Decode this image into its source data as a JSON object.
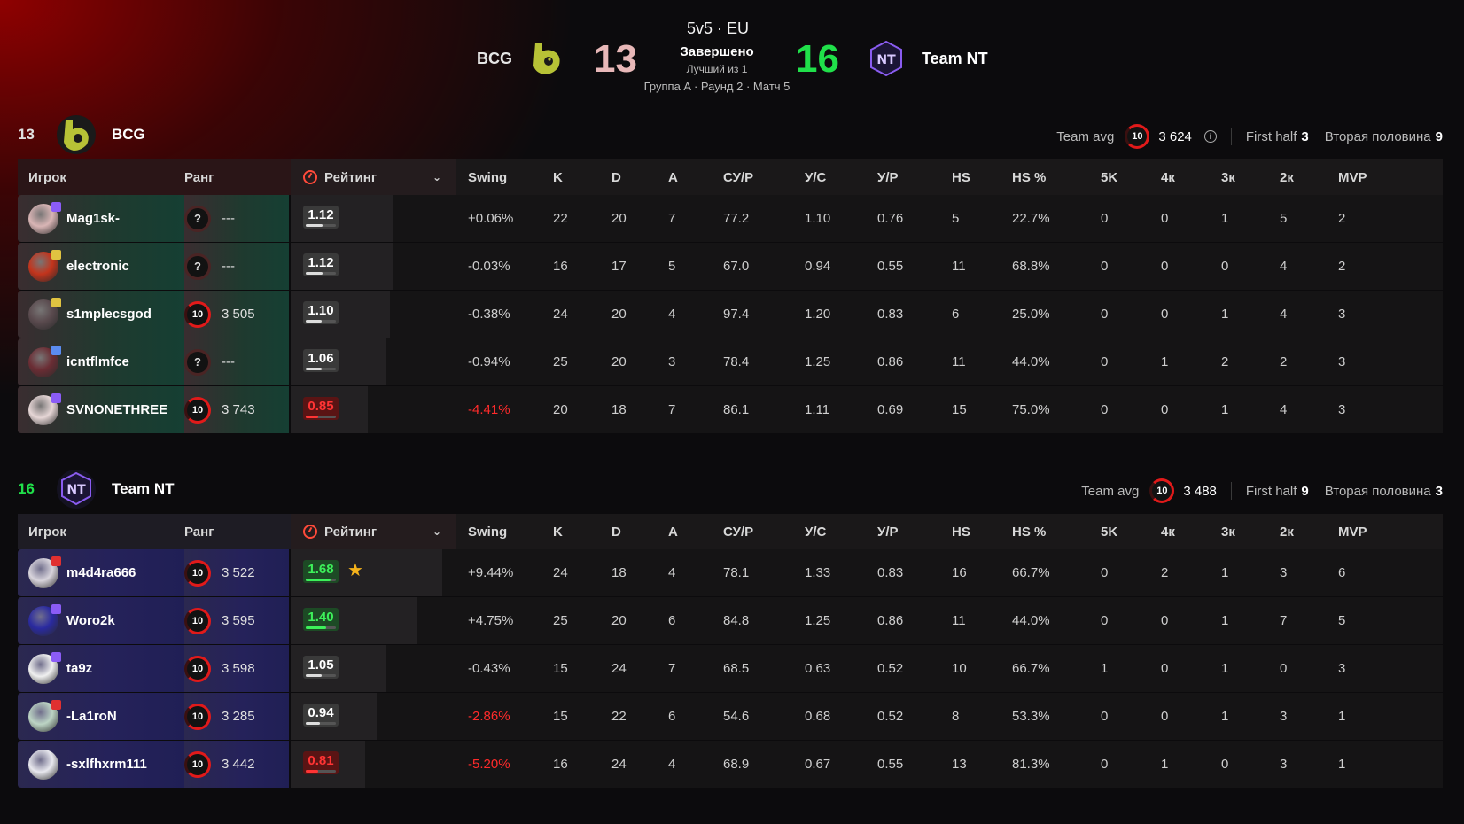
{
  "match": {
    "mode": "5v5 · EU",
    "status": "Завершено",
    "best_of": "Лучший из 1",
    "group_info": "Группа A · Раунд 2 · Матч 5",
    "left_team": "BCG",
    "right_team": "Team NT",
    "left_score": "13",
    "right_score": "16"
  },
  "labels": {
    "team_avg": "Team avg",
    "first_half": "First half",
    "second_half": "Вторая половина",
    "col_player": "Игрок",
    "col_rank": "Ранг",
    "col_rating": "Рейтинг",
    "col_swing": "Swing",
    "col_k": "K",
    "col_d": "D",
    "col_a": "A",
    "col_adr": "СУ/Р",
    "col_kd": "У/С",
    "col_kr": "У/Р",
    "col_hs": "HS",
    "col_hsp": "HS %",
    "col_5k": "5K",
    "col_4k": "4к",
    "col_3k": "3к",
    "col_2k": "2к",
    "col_mvp": "MVP"
  },
  "colors": {
    "accent_red": "#e11a1a",
    "win_green": "#20e04a",
    "lose_score": "#e8b8b8",
    "rating_good": "#3df05a",
    "rating_bad": "#ff3434",
    "star": "#f5b21b"
  },
  "teams": [
    {
      "score": "13",
      "name": "BCG",
      "score_color": "#e0e0e0",
      "team_avg_level": "10",
      "team_avg_elo": "3 624",
      "first_half": "3",
      "second_half": "9",
      "players": [
        {
          "name": "Mag1sk-",
          "level": "?",
          "elo": "---",
          "rating": "1.12",
          "rating_fraction": 0.62,
          "rating_kind": "normal",
          "star": "",
          "swing": "+0.06%",
          "swing_red": false,
          "k": "22",
          "d": "20",
          "a": "7",
          "adr": "77.2",
          "kd": "1.10",
          "kr": "0.76",
          "hs": "5",
          "hsp": "22.7%",
          "k5": "0",
          "k4": "0",
          "k3": "1",
          "k2": "5",
          "mvp": "2",
          "avatar": "#d9b5b5",
          "tag": "#8b5cf6"
        },
        {
          "name": "electronic",
          "level": "?",
          "elo": "---",
          "rating": "1.12",
          "rating_fraction": 0.62,
          "rating_kind": "normal",
          "star": "",
          "swing": "-0.03%",
          "swing_red": false,
          "k": "16",
          "d": "17",
          "a": "5",
          "adr": "67.0",
          "kd": "0.94",
          "kr": "0.55",
          "hs": "11",
          "hsp": "68.8%",
          "k5": "0",
          "k4": "0",
          "k3": "0",
          "k2": "4",
          "mvp": "2",
          "avatar": "#c3341c",
          "tag": "#e0c341"
        },
        {
          "name": "s1mplecsgod",
          "level": "10",
          "elo": "3 505",
          "rating": "1.10",
          "rating_fraction": 0.6,
          "rating_kind": "normal",
          "star": "",
          "swing": "-0.38%",
          "swing_red": false,
          "k": "24",
          "d": "20",
          "a": "4",
          "adr": "97.4",
          "kd": "1.20",
          "kr": "0.83",
          "hs": "6",
          "hsp": "25.0%",
          "k5": "0",
          "k4": "0",
          "k3": "1",
          "k2": "4",
          "mvp": "3",
          "avatar": "#5a4a4e",
          "tag": "#e0c341"
        },
        {
          "name": "icntflmfce",
          "level": "?",
          "elo": "---",
          "rating": "1.06",
          "rating_fraction": 0.58,
          "rating_kind": "normal",
          "star": "",
          "swing": "-0.94%",
          "swing_red": false,
          "k": "25",
          "d": "20",
          "a": "3",
          "adr": "78.4",
          "kd": "1.25",
          "kr": "0.86",
          "hs": "11",
          "hsp": "44.0%",
          "k5": "0",
          "k4": "1",
          "k3": "2",
          "k2": "2",
          "mvp": "3",
          "avatar": "#6b2d34",
          "tag": "#5b8cf0"
        },
        {
          "name": "SVNONETHREE",
          "level": "10",
          "elo": "3 743",
          "rating": "0.85",
          "rating_fraction": 0.47,
          "rating_kind": "bad",
          "star": "",
          "swing": "-4.41%",
          "swing_red": true,
          "k": "20",
          "d": "18",
          "a": "7",
          "adr": "86.1",
          "kd": "1.11",
          "kr": "0.69",
          "hs": "15",
          "hsp": "75.0%",
          "k5": "0",
          "k4": "0",
          "k3": "1",
          "k2": "4",
          "mvp": "3",
          "avatar": "#e6d6d6",
          "tag": "#8b5cf6"
        }
      ]
    },
    {
      "score": "16",
      "name": "Team NT",
      "score_color": "#20e04a",
      "team_avg_level": "10",
      "team_avg_elo": "3 488",
      "first_half": "9",
      "second_half": "3",
      "players": [
        {
          "name": "m4d4ra666",
          "level": "10",
          "elo": "3 522",
          "rating": "1.68",
          "rating_fraction": 0.92,
          "rating_kind": "good",
          "star": "★",
          "swing": "+9.44%",
          "swing_red": false,
          "k": "24",
          "d": "18",
          "a": "4",
          "adr": "78.1",
          "kd": "1.33",
          "kr": "0.83",
          "hs": "16",
          "hsp": "66.7%",
          "k5": "0",
          "k4": "2",
          "k3": "1",
          "k2": "3",
          "mvp": "6",
          "avatar": "#d8d4dc",
          "tag": "#e03030"
        },
        {
          "name": "Woro2k",
          "level": "10",
          "elo": "3 595",
          "rating": "1.40",
          "rating_fraction": 0.77,
          "rating_kind": "good",
          "star": "",
          "swing": "+4.75%",
          "swing_red": false,
          "k": "25",
          "d": "20",
          "a": "6",
          "adr": "84.8",
          "kd": "1.25",
          "kr": "0.86",
          "hs": "11",
          "hsp": "44.0%",
          "k5": "0",
          "k4": "0",
          "k3": "1",
          "k2": "7",
          "mvp": "5",
          "avatar": "#2a2aa0",
          "tag": "#8b5cf6"
        },
        {
          "name": "ta9z",
          "level": "10",
          "elo": "3 598",
          "rating": "1.05",
          "rating_fraction": 0.58,
          "rating_kind": "normal",
          "star": "",
          "swing": "-0.43%",
          "swing_red": false,
          "k": "15",
          "d": "24",
          "a": "7",
          "adr": "68.5",
          "kd": "0.63",
          "kr": "0.52",
          "hs": "10",
          "hsp": "66.7%",
          "k5": "1",
          "k4": "0",
          "k3": "1",
          "k2": "0",
          "mvp": "3",
          "avatar": "#f0f0f0",
          "tag": "#8b5cf6"
        },
        {
          "name": "-La1roN",
          "level": "10",
          "elo": "3 285",
          "rating": "0.94",
          "rating_fraction": 0.52,
          "rating_kind": "normal",
          "star": "",
          "swing": "-2.86%",
          "swing_red": true,
          "k": "15",
          "d": "22",
          "a": "6",
          "adr": "54.6",
          "kd": "0.68",
          "kr": "0.52",
          "hs": "8",
          "hsp": "53.3%",
          "k5": "0",
          "k4": "0",
          "k3": "1",
          "k2": "3",
          "mvp": "1",
          "avatar": "#bcd4c4",
          "tag": "#e03030"
        },
        {
          "name": "-sxlfhxrm111",
          "level": "10",
          "elo": "3 442",
          "rating": "0.81",
          "rating_fraction": 0.45,
          "rating_kind": "bad",
          "star": "",
          "swing": "-5.20%",
          "swing_red": true,
          "k": "16",
          "d": "24",
          "a": "4",
          "adr": "68.9",
          "kd": "0.67",
          "kr": "0.55",
          "hs": "13",
          "hsp": "81.3%",
          "k5": "0",
          "k4": "1",
          "k3": "0",
          "k2": "3",
          "mvp": "1",
          "avatar": "#e8e8ee",
          "tag": ""
        }
      ]
    }
  ]
}
